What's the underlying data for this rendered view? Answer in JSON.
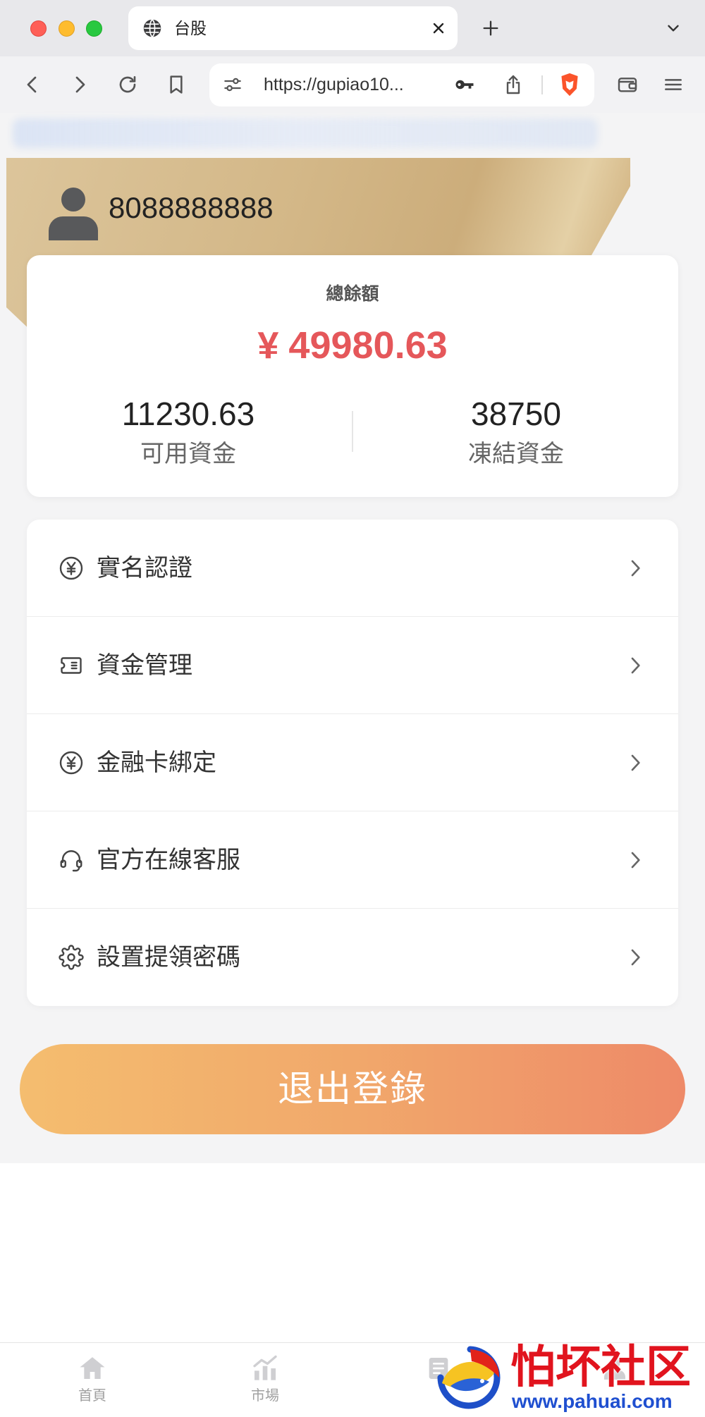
{
  "browser": {
    "tab_title": "台股",
    "url": "https://gupiao10...",
    "toolbar_icons": [
      "back-icon",
      "forward-icon",
      "reload-icon",
      "bookmark-icon",
      "site-settings-icon",
      "key-icon",
      "share-icon",
      "brave-shields-icon",
      "wallet-icon",
      "menu-icon"
    ]
  },
  "account": {
    "username": "8088888888"
  },
  "balance": {
    "title": "總餘額",
    "currency_symbol": "¥",
    "total": "49980.63",
    "available": {
      "value": "11230.63",
      "label": "可用資金"
    },
    "frozen": {
      "value": "38750",
      "label": "凍結資金"
    }
  },
  "menu": [
    {
      "label": "實名認證",
      "icon": "yen-circle-icon"
    },
    {
      "label": "資金管理",
      "icon": "ticket-icon"
    },
    {
      "label": "金融卡綁定",
      "icon": "yen-circle-icon"
    },
    {
      "label": "官方在線客服",
      "icon": "headset-icon"
    },
    {
      "label": "設置提領密碼",
      "icon": "gear-icon"
    }
  ],
  "logout": {
    "label": "退出登錄"
  },
  "bottom_nav": [
    {
      "label": "首頁",
      "icon": "home-icon"
    },
    {
      "label": "市場",
      "icon": "chart-icon"
    },
    {
      "icon": "trade-icon"
    },
    {
      "icon": "user-icon"
    }
  ],
  "watermark": {
    "title": "怕坏社区",
    "url": "www.pahuai.com"
  },
  "colors": {
    "amount": "#e5575a",
    "banner_gold": "#d3b787",
    "logout_gradient_start": "#f4bd6f",
    "logout_gradient_end": "#ee8a68",
    "page_background": "#f4f4f5",
    "watermark_red": "#e1141e",
    "watermark_blue": "#1f4fd0"
  }
}
